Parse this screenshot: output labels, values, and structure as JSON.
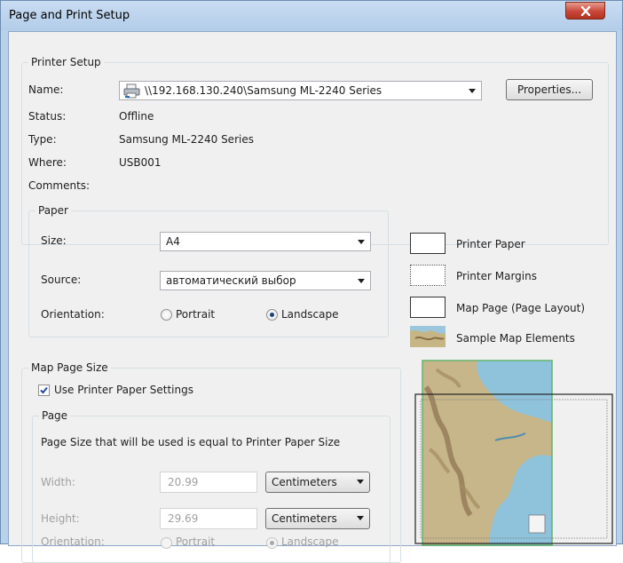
{
  "window": {
    "title": "Page and Print Setup"
  },
  "printer_setup": {
    "group_label": "Printer Setup",
    "name_label": "Name:",
    "name_value": "\\\\192.168.130.240\\Samsung ML-2240 Series",
    "properties_label": "Properties...",
    "status_label": "Status:",
    "status_value": "Offline",
    "type_label": "Type:",
    "type_value": "Samsung ML-2240 Series",
    "where_label": "Where:",
    "where_value": "USB001",
    "comments_label": "Comments:"
  },
  "paper": {
    "group_label": "Paper",
    "size_label": "Size:",
    "size_value": "A4",
    "source_label": "Source:",
    "source_value": "автоматический выбор",
    "orientation_label": "Orientation:",
    "portrait_label": "Portrait",
    "landscape_label": "Landscape",
    "selected_orientation": "Landscape"
  },
  "legend": {
    "printer_paper": "Printer Paper",
    "printer_margins": "Printer Margins",
    "map_page": "Map Page (Page Layout)",
    "sample_map_elements": "Sample Map Elements"
  },
  "map_page_size": {
    "group_label": "Map Page Size",
    "use_printer_paper_label": "Use Printer Paper Settings",
    "use_printer_paper_checked": true,
    "page_group_label": "Page",
    "info_text": "Page Size that will be used is equal to Printer Paper Size",
    "width_label": "Width:",
    "width_value": "20.99",
    "width_unit": "Centimeters",
    "height_label": "Height:",
    "height_value": "29.69",
    "height_unit": "Centimeters",
    "orientation_label": "Orientation:",
    "portrait_label": "Portrait",
    "landscape_label": "Landscape"
  },
  "colors": {
    "title_bar": "#b9d1ea",
    "close_button": "#c8473a",
    "map_land": "#c7b68a",
    "map_water": "#8fc3dc"
  }
}
